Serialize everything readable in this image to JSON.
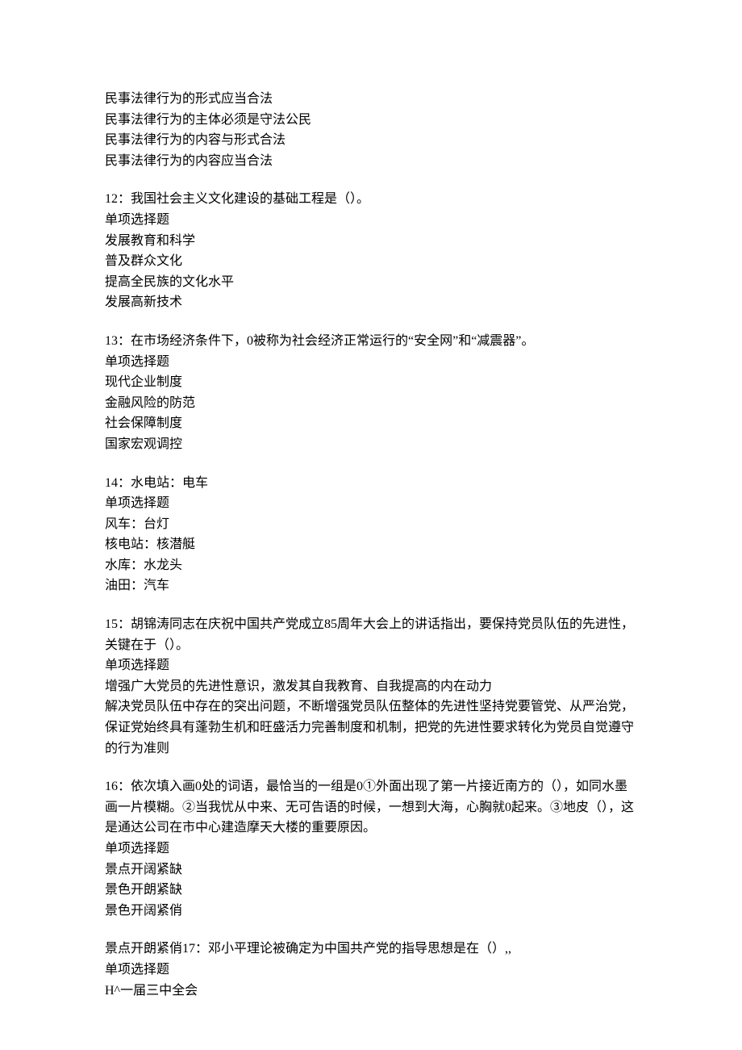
{
  "blocks": [
    {
      "lines": [
        "民事法律行为的形式应当合法",
        "民事法律行为的主体必须是守法公民",
        "民事法律行为的内容与形式合法",
        "民事法律行为的内容应当合法"
      ]
    },
    {
      "lines": [
        "12：我国社会主义文化建设的基础工程是（）。",
        "单项选择题",
        "发展教育和科学",
        "普及群众文化",
        "提高全民族的文化水平",
        "发展高新技术"
      ]
    },
    {
      "lines": [
        "13：在市场经济条件下，0被称为社会经济正常运行的“安全网”和“减震器”。",
        "单项选择题",
        "现代企业制度",
        "金融风险的防范",
        "社会保障制度",
        "国家宏观调控"
      ]
    },
    {
      "lines": [
        "14：水电站：电车",
        "单项选择题",
        "风车：台灯",
        "核电站：核潜艇",
        "水库：水龙头",
        "油田：汽车"
      ]
    },
    {
      "lines": [
        "15：胡锦涛同志在庆祝中国共产党成立85周年大会上的讲话指出，要保持党员队伍的先进性，关键在于（）。",
        "单项选择题",
        "增强广大党员的先进性意识，激发其自我教育、自我提高的内在动力",
        "解决党员队伍中存在的突出问题，不断增强党员队伍整体的先进性坚持党要管党、从严治党，保证党始终具有蓬勃生机和旺盛活力完善制度和机制，把党的先进性要求转化为党员自觉遵守的行为准则"
      ]
    },
    {
      "lines": [
        "16：依次填入画0处的词语，最恰当的一组是0①外面出现了第一片接近南方的（），如同水墨画一片模糊。②当我忧从中来、无可告语的时候，一想到大海，心胸就0起来。③地皮（），这是通达公司在市中心建造摩天大楼的重要原因。",
        "单项选择题",
        "景点开阔紧缺",
        "景色开朗紧缺",
        "景色开阔紧俏"
      ]
    },
    {
      "lines": [
        "景点开朗紧俏17：邓小平理论被确定为中国共产党的指导思想是在（）,,",
        "单项选择题",
        "H^一届三中全会"
      ]
    }
  ]
}
